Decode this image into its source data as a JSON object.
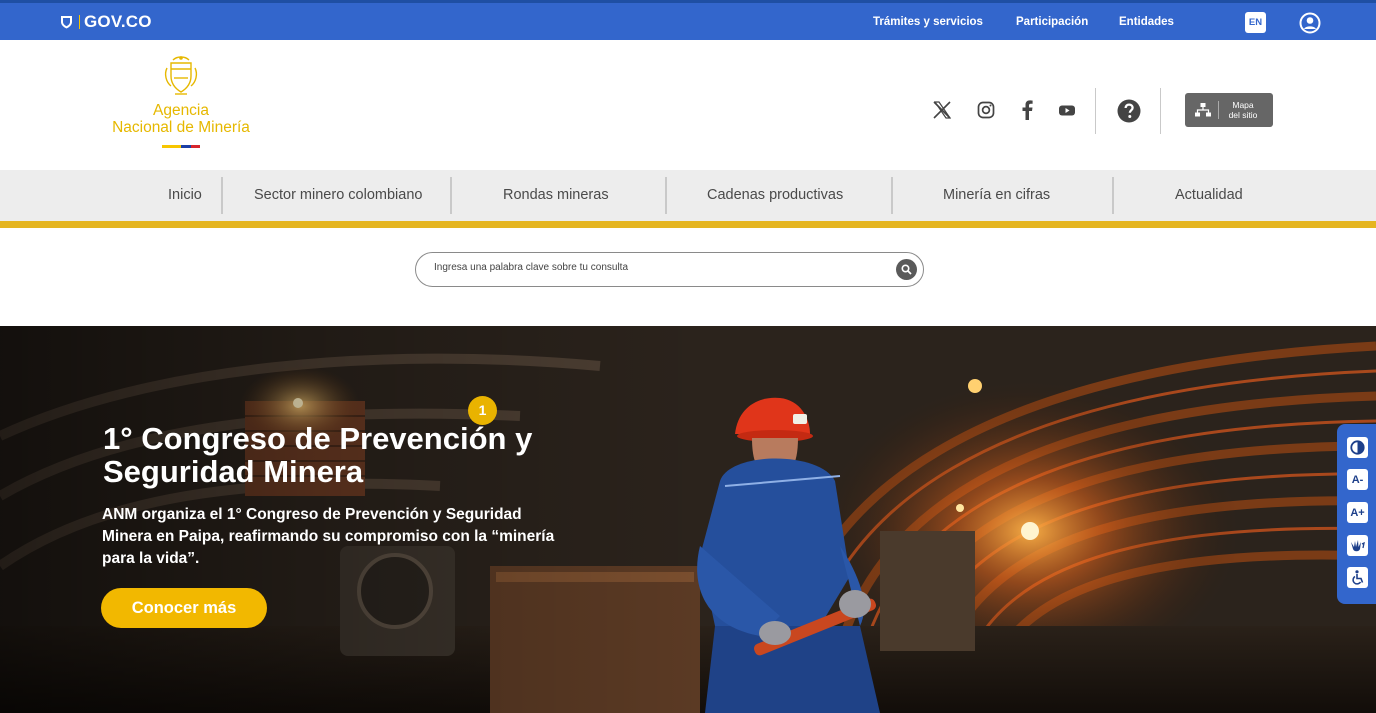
{
  "govbar": {
    "logo_text": "GOV.CO",
    "links": [
      "Trámites y servicios",
      "Participación",
      "Entidades"
    ],
    "lang_button": "EN",
    "icons": [
      "colombia-shield-icon",
      "user-circle-icon"
    ]
  },
  "header": {
    "agency_line1": "Agencia",
    "agency_line2": "Nacional de Minería",
    "social_icons": [
      "x-icon",
      "instagram-icon",
      "facebook-icon",
      "youtube-icon"
    ],
    "help_icon": "question-circle-icon",
    "sitemap": {
      "line1": "Mapa",
      "line2": "del sitio",
      "icon": "sitemap-icon"
    }
  },
  "nav": {
    "items": [
      "Inicio",
      "Sector minero colombiano",
      "Rondas mineras",
      "Cadenas productivas",
      "Minería en cifras",
      "Actualidad"
    ]
  },
  "search": {
    "placeholder": "Ingresa una palabra clave sobre tu consulta",
    "icon": "search-icon"
  },
  "hero": {
    "slide_number": "1",
    "title": "1° Congreso de Prevención y Seguridad Minera",
    "description": "ANM organiza el 1° Congreso de Prevención y Seguridad Minera en Paipa, reafirmando su compromiso con la “minería para la vida”.",
    "cta": "Conocer más"
  },
  "accessibility": {
    "buttons": [
      {
        "icon": "contrast-icon",
        "label": ""
      },
      {
        "icon": "decrease-text-icon",
        "label": "A-"
      },
      {
        "icon": "increase-text-icon",
        "label": "A+"
      },
      {
        "icon": "sign-language-icon",
        "label": ""
      },
      {
        "icon": "wheelchair-icon",
        "label": ""
      }
    ]
  },
  "colors": {
    "gov_blue": "#3366cc",
    "gold": "#e5b520",
    "button_yellow": "#f2b800",
    "nav_bg": "#ededed"
  }
}
